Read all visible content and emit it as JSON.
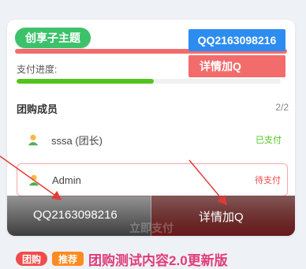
{
  "brand": {
    "label": "创享子主题"
  },
  "badges": {
    "qq": "QQ2163098216",
    "detail": "详情加Q"
  },
  "progress": {
    "label": "支付进度:",
    "fraction": 0.52,
    "fill_color": "#52c41a"
  },
  "members": {
    "title": "团购成员",
    "count": "2/2",
    "items": [
      {
        "name": "sssa (团长)",
        "status": "已支付",
        "status_color": "#52c41a",
        "avatar_icon": "user-avatar-icon"
      },
      {
        "name": "Admin",
        "status": "待支付",
        "status_color": "#f04b4b",
        "avatar_icon": "user-avatar-icon"
      }
    ]
  },
  "overlay": {
    "left_text": "QQ2163098216",
    "right_text": "详情加Q",
    "pay_button": "立即支付"
  },
  "bottom": {
    "tag1": "团购",
    "tag2": "推荐",
    "title": "团购测试内容2.0更新版"
  },
  "colors": {
    "accent_green": "#3cc26a",
    "accent_blue": "#2d8cf0",
    "accent_red": "#f36c6c"
  }
}
